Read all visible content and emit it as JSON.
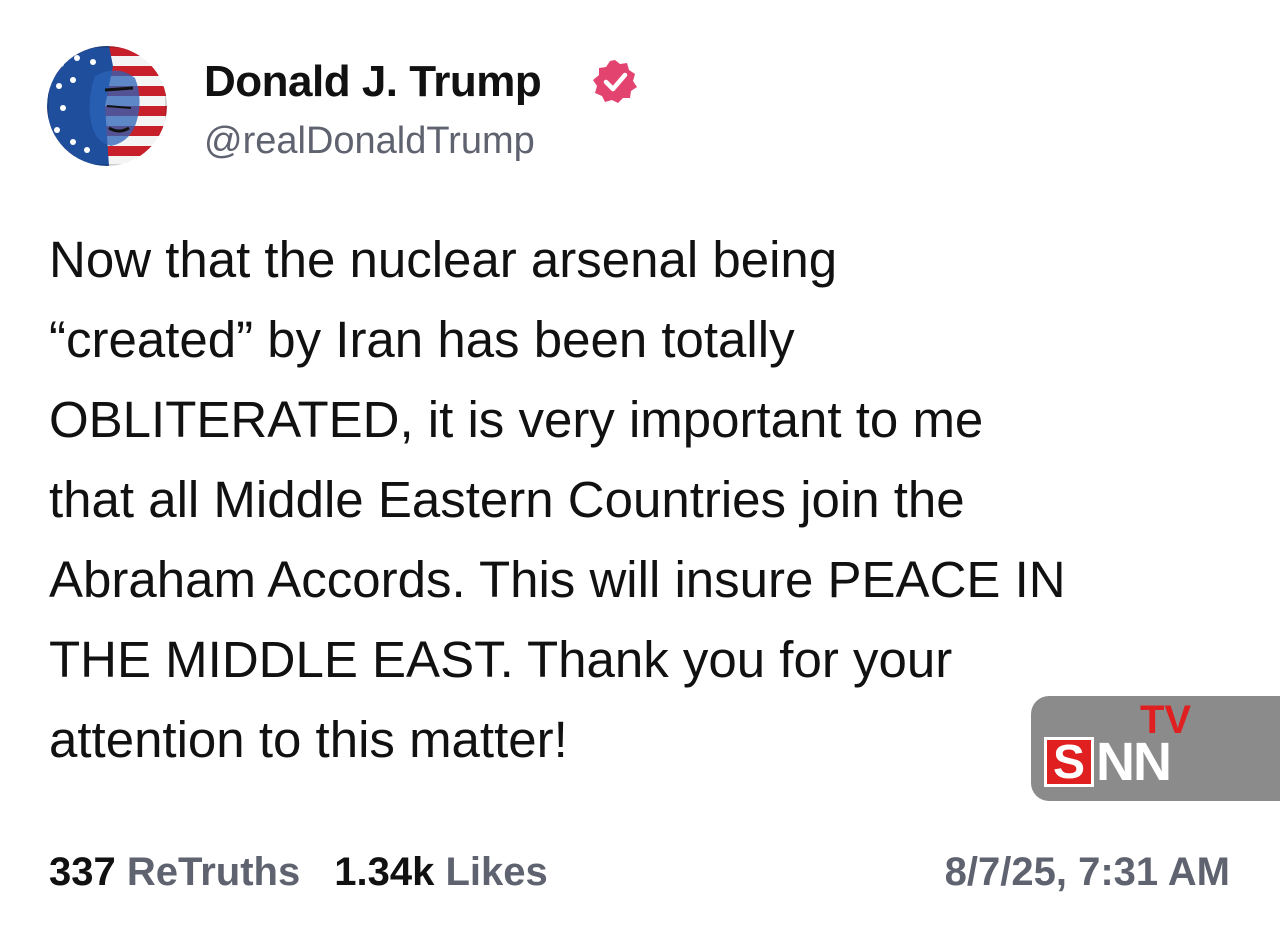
{
  "author": {
    "name": "Donald J. Trump",
    "handle": "@realDonaldTrump",
    "verified_icon": "verified-badge-icon",
    "verified_color": "#e3446f"
  },
  "post": {
    "lines": [
      "Now that the nuclear arsenal being",
      "“created” by Iran has been totally",
      "OBLITERATED, it is very important to me",
      "that all Middle Eastern Countries join the",
      "Abraham Accords. This will insure PEACE IN",
      "THE MIDDLE EAST. Thank you for your",
      "attention to this matter!"
    ]
  },
  "stats": {
    "retruths_count": "337",
    "retruths_label": "ReTruths",
    "likes_count": "1.34k",
    "likes_label": "Likes"
  },
  "timestamp": "8/7/25, 7:31 AM",
  "watermark": {
    "tv": "TV",
    "s": "S",
    "nn": "NN",
    "accent_color": "#e02020",
    "background_color": "#8b8b8b"
  }
}
